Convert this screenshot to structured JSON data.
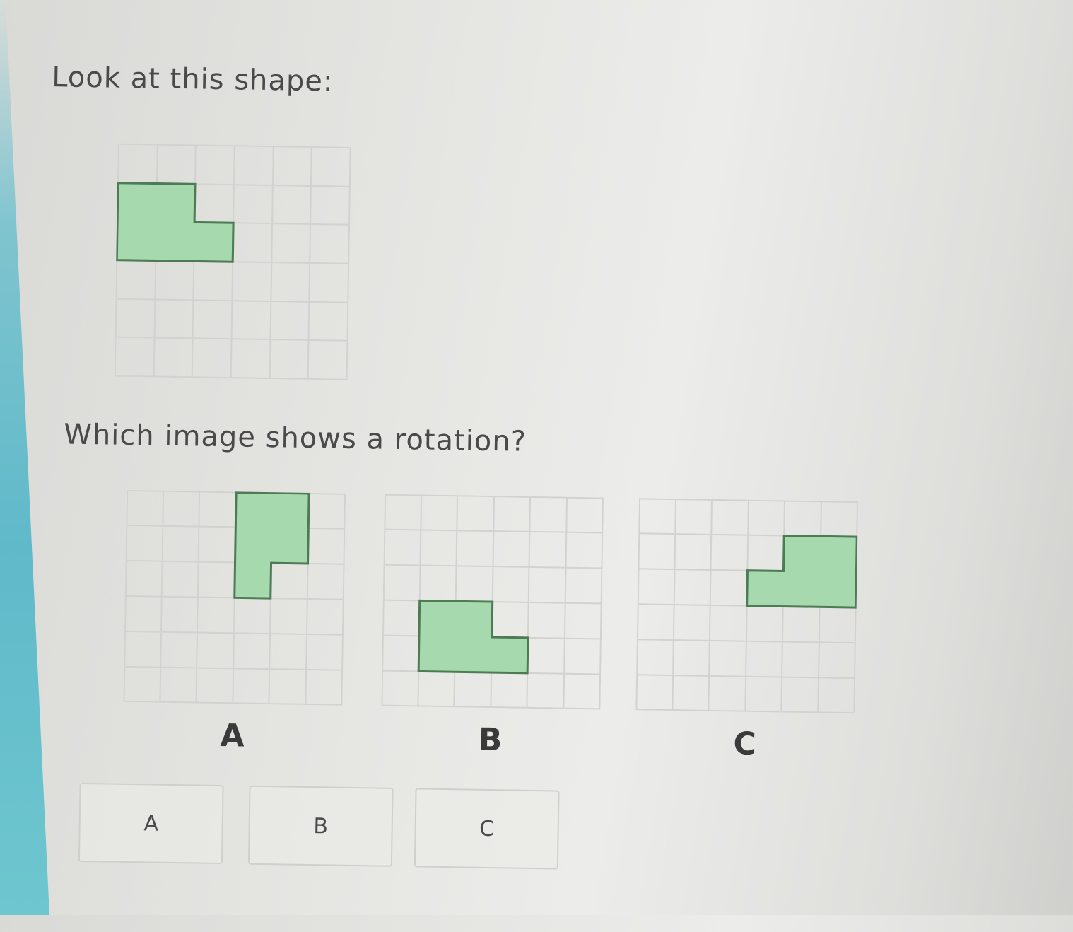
{
  "question": {
    "intro": "Look at this shape:",
    "prompt": "Which image shows a rotation?"
  },
  "colors": {
    "shape_fill": "#a6d9ad",
    "shape_stroke": "#4f7a56",
    "grid_line": "#d2d2d0"
  },
  "choices": [
    {
      "label": "A"
    },
    {
      "label": "B"
    },
    {
      "label": "C"
    }
  ],
  "answers": [
    {
      "label": "A"
    },
    {
      "label": "B"
    },
    {
      "label": "C"
    }
  ]
}
